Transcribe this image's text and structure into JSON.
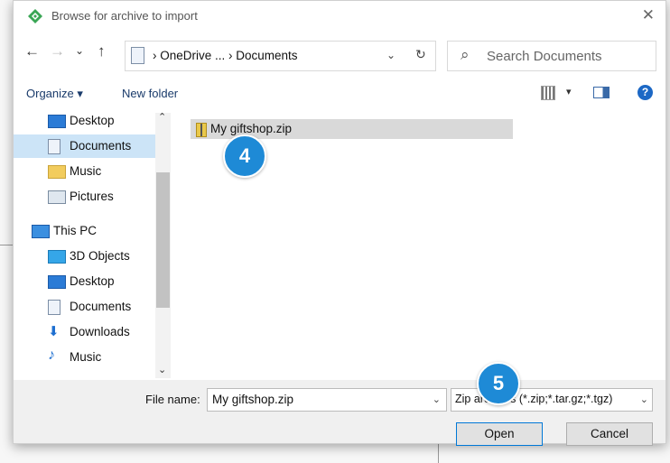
{
  "window": {
    "title": "Browse for archive to import",
    "close_glyph": "✕"
  },
  "nav": {
    "back_glyph": "←",
    "forward_glyph": "→",
    "recent_glyph": "⌄",
    "up_glyph": "↑",
    "breadcrumb": "› OneDrive ... › Documents",
    "dropdown_glyph": "⌄",
    "refresh_glyph": "↻"
  },
  "search": {
    "placeholder": "Search Documents",
    "icon_glyph": "⌕"
  },
  "toolbar": {
    "organize_label": "Organize ▾",
    "new_folder_label": "New folder",
    "help_glyph": "?"
  },
  "sidebar": {
    "items": [
      {
        "label": "Desktop",
        "icon": "desktop-icon",
        "indent": 1
      },
      {
        "label": "Documents",
        "icon": "documents-icon",
        "indent": 1,
        "selected": true
      },
      {
        "label": "Music",
        "icon": "folder-icon",
        "indent": 1
      },
      {
        "label": "Pictures",
        "icon": "pictures-icon",
        "indent": 1
      },
      {
        "label": "This PC",
        "icon": "pc-icon",
        "indent": 0
      },
      {
        "label": "3D Objects",
        "icon": "3d-objects-icon",
        "indent": 1
      },
      {
        "label": "Desktop",
        "icon": "desktop-icon",
        "indent": 1
      },
      {
        "label": "Documents",
        "icon": "documents-icon",
        "indent": 1
      },
      {
        "label": "Downloads",
        "icon": "downloads-icon",
        "indent": 1
      },
      {
        "label": "Music",
        "icon": "music-icon",
        "indent": 1
      }
    ],
    "scroll_up_glyph": "⌃",
    "scroll_down_glyph": "⌄"
  },
  "files": [
    {
      "name": "My giftshop.zip",
      "selected": true
    }
  ],
  "badges": {
    "step4": "4",
    "step5": "5"
  },
  "bottom": {
    "file_name_label": "File name:",
    "file_name_value": "My giftshop.zip",
    "file_type_value": "Zip archives (*.zip;*.tar.gz;*.tgz)",
    "open_label": "Open",
    "cancel_label": "Cancel",
    "chevron": "⌄"
  },
  "colors": {
    "accent": "#1e8ad6",
    "selection": "#cce4f7",
    "link": "#1a3b6b"
  }
}
